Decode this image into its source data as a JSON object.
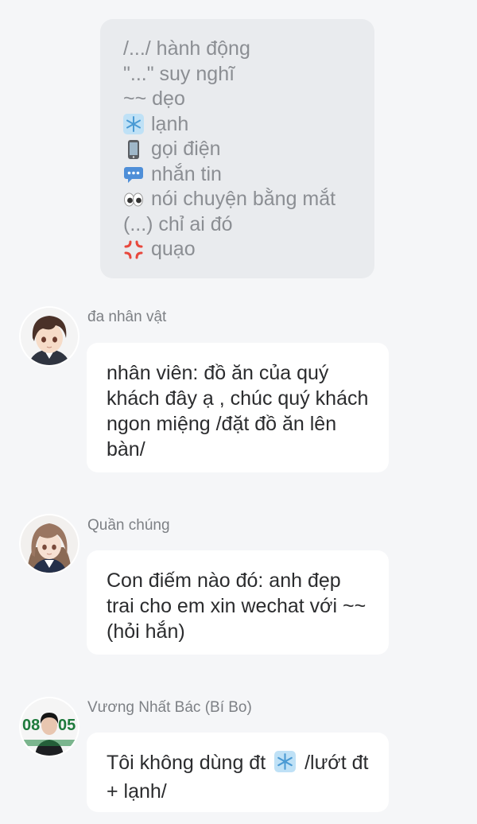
{
  "legend": {
    "items": [
      {
        "icon": "",
        "text": "/.../ hành động"
      },
      {
        "icon": "",
        "text": "\"...\" suy nghĩ"
      },
      {
        "icon": "",
        "text": "~~ dẹo"
      },
      {
        "icon": "snowflake-icon",
        "text": "lạnh"
      },
      {
        "icon": "mobile-phone-icon",
        "text": "gọi điện"
      },
      {
        "icon": "speech-bubble-icon",
        "text": "nhắn tin"
      },
      {
        "icon": "eyes-icon",
        "text": "nói chuyện bằng mắt"
      },
      {
        "icon": "",
        "text": "(...) chỉ ai đó"
      },
      {
        "icon": "anger-icon",
        "text": "quạo"
      }
    ]
  },
  "messages": [
    {
      "sender": "đa nhân vật",
      "avatar": "anime-boy-avatar",
      "text": "nhân viên: đồ ăn của quý khách đây ạ , chúc quý khách ngon miệng /đặt đồ ăn lên bàn/"
    },
    {
      "sender": "Quần chúng",
      "avatar": "anime-girl-avatar",
      "text": "Con điếm nào đó: anh đẹp trai cho em xin wechat với ~~ (hỏi hắn)"
    },
    {
      "sender": "Vương Nhất Bác (Bí Bo)",
      "avatar": "photo-avatar",
      "text_before": "Tôi không dùng đt",
      "text_after": "/lướt đt + lạnh/"
    }
  ],
  "colors": {
    "background": "#f5f6f8",
    "legend_bg": "#e9ebee",
    "legend_text": "#8b8e93",
    "bubble_bg": "#ffffff",
    "message_text": "#2b2c2e",
    "sender_text": "#7d8085"
  }
}
